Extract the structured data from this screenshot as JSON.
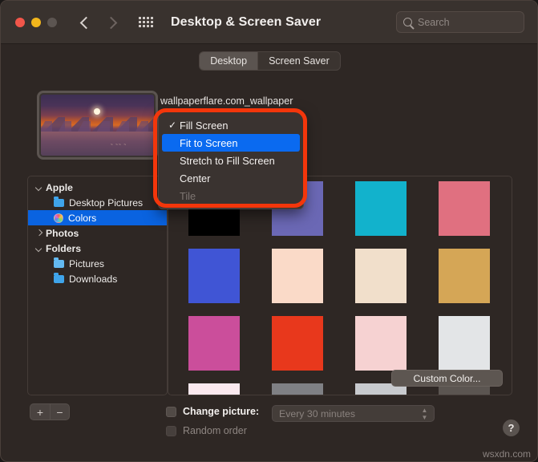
{
  "window": {
    "title": "Desktop & Screen Saver",
    "traffic_lights": [
      "close",
      "minimize",
      "zoom"
    ],
    "nav": {
      "back_icon": "chevron-left-icon",
      "forward_icon": "chevron-right-icon"
    },
    "grid_icon": "app-grid-icon",
    "bg_color": "#2e2724",
    "titlebar_color": "#39322e"
  },
  "search": {
    "placeholder": "Search",
    "icon": "search-icon"
  },
  "tabs": [
    {
      "label": "Desktop",
      "active": true
    },
    {
      "label": "Screen Saver",
      "active": false
    }
  ],
  "preview": {
    "label": "wallpaperflare.com_wallpaper",
    "description": "sunset mountains lake wallpaper thumbnail"
  },
  "dropdown": {
    "open": true,
    "items": [
      {
        "label": "Fill Screen",
        "checked": true,
        "highlighted": false,
        "disabled": false
      },
      {
        "label": "Fit to Screen",
        "checked": false,
        "highlighted": true,
        "disabled": false
      },
      {
        "label": "Stretch to Fill Screen",
        "checked": false,
        "highlighted": false,
        "disabled": false
      },
      {
        "label": "Center",
        "checked": false,
        "highlighted": false,
        "disabled": false
      },
      {
        "label": "Tile",
        "checked": false,
        "highlighted": false,
        "disabled": true
      }
    ],
    "highlight_color": "#0a6af0",
    "annotation_color": "#f3360b"
  },
  "sidebar": {
    "items": [
      {
        "label": "Apple",
        "type": "group",
        "expanded": true,
        "indent": 0,
        "icon": "disclosure-open-icon",
        "selected": false
      },
      {
        "label": "Desktop Pictures",
        "type": "folder",
        "indent": 1,
        "icon": "folder-icon",
        "selected": false
      },
      {
        "label": "Colors",
        "type": "colorwheel",
        "indent": 1,
        "icon": "color-wheel-icon",
        "selected": true
      },
      {
        "label": "Photos",
        "type": "group",
        "expanded": false,
        "indent": 0,
        "icon": "disclosure-closed-icon",
        "selected": false
      },
      {
        "label": "Folders",
        "type": "group",
        "expanded": true,
        "indent": 0,
        "icon": "disclosure-open-icon",
        "selected": false
      },
      {
        "label": "Pictures",
        "type": "folder",
        "indent": 1,
        "icon": "folder-icon",
        "selected": false
      },
      {
        "label": "Downloads",
        "type": "folder",
        "indent": 1,
        "icon": "folder-icon",
        "selected": false
      }
    ],
    "selection_color": "#0a63e0",
    "add_button": "+",
    "remove_button": "−"
  },
  "swatches": {
    "columns": 4,
    "colors": [
      "#000000",
      "#6b68b5",
      "#12b2cc",
      "#e07080",
      "#4055d5",
      "#fadac8",
      "#f1dfcb",
      "#d5a656",
      "#cb4e9b",
      "#e8381c",
      "#f6d2d2",
      "#e3e5e7",
      "#fbe9ef",
      "#7f8084",
      "#c8cace",
      "#5b5551"
    ],
    "custom_color_label": "Custom Color..."
  },
  "bottom": {
    "change_picture_label": "Change picture:",
    "change_picture_checked": false,
    "change_picture_enabled": true,
    "interval_value": "Every 30 minutes",
    "interval_enabled": false,
    "random_order_label": "Random order",
    "random_order_checked": false,
    "random_order_enabled": false,
    "help_label": "?"
  },
  "watermark": "wsxdn.com"
}
